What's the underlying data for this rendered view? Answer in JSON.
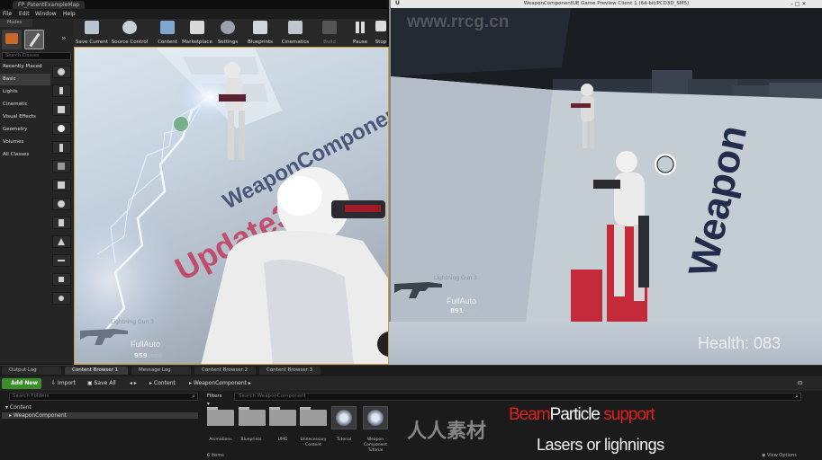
{
  "editor": {
    "level_tab": "FP_PatentExampleMap",
    "menu": [
      "File",
      "Edit",
      "Window",
      "Help"
    ]
  },
  "modes": {
    "tab": "Modes",
    "search_placeholder": "Search Classes",
    "categories": [
      "Recently Placed",
      "Basic",
      "Lights",
      "Cinematic",
      "Visual Effects",
      "Geometry",
      "Volumes",
      "All Classes"
    ],
    "selected_category": "Basic"
  },
  "toolbar": {
    "buttons": [
      "Save Current",
      "Source Control",
      "Content",
      "Marketplace",
      "Settings",
      "Blueprints",
      "Cinematics",
      "Build",
      "Pause",
      "Stop"
    ]
  },
  "viewport": {
    "weapon_name": "Lightning Gun",
    "weapon_slot": "3",
    "fire_mode": "FullAuto",
    "ammo": "959",
    "ammo_max": "/9000",
    "floor_text": "WeaponComponent",
    "floor_sub": "Update3"
  },
  "preview": {
    "title": "WeaponComponentUE Game Preview Client 1 (64-bit/PCD3D_SM5)",
    "weapon_name": "Lightning Gun",
    "weapon_slot": "3",
    "fire_mode": "FullAuto",
    "ammo": "891",
    "ammo_max": "/9000",
    "floor_text": "Weapon",
    "health": "Health: 083"
  },
  "bottom": {
    "tabs": [
      "Output Log",
      "Content Browser 1",
      "Message Log",
      "Content Browser 2",
      "Content Browser 3"
    ],
    "active_tab": "Content Browser 1",
    "add_new": "Add New",
    "import": "Import",
    "save_all": "Save All",
    "path": [
      "Content",
      "WeaponComponent"
    ],
    "search_folders_placeholder": "Search Folders",
    "filters": "Filters",
    "search_assets_placeholder": "Search WeaponComponent",
    "tree": [
      "Content",
      "WeaponComponent"
    ],
    "folders": [
      "Animations",
      "Blueprints",
      "UMG",
      "Unnecessary Content"
    ],
    "assets": [
      "Tutorial",
      "Weapon Component Tutorial"
    ],
    "item_count": "6 items",
    "view_options": "View Options"
  },
  "overlay": {
    "beam_word": "Beam",
    "particle_word": "Particle",
    "support_word": "support",
    "line2": "Lasers or lighnings",
    "beam_color": "#e0201e",
    "particle_color": "#ffffff"
  },
  "watermarks": {
    "site": "www.rrcg.cn",
    "cn": "人人素材"
  }
}
